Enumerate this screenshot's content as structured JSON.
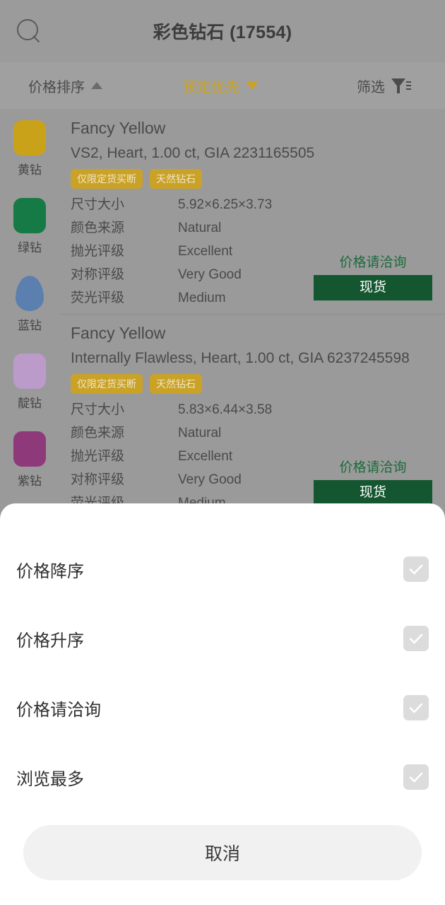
{
  "header": {
    "search_icon": "search-icon",
    "title": "彩色钻石 (17554)"
  },
  "toolbar": {
    "sort_label": "价格排序",
    "sort_caret": "caret-up-icon",
    "booking_label": "预定优先",
    "booking_caret": "caret-down-icon",
    "filter_label": "筛选",
    "filter_icon": "filter-icon",
    "active_color": "#c9a227"
  },
  "rail": {
    "items": [
      {
        "label": "黄钻",
        "color": "#c9a21a",
        "shape": "cushion"
      },
      {
        "label": "绿钻",
        "color": "#157a45",
        "shape": "cushion"
      },
      {
        "label": "蓝钻",
        "color": "#5b7fae",
        "shape": "pear"
      },
      {
        "label": "靛钻",
        "color": "#bb9bc9",
        "shape": "cushion"
      },
      {
        "label": "紫钻",
        "color": "#8e3a7a",
        "shape": "cushion"
      }
    ]
  },
  "listings": [
    {
      "title": "Fancy Yellow",
      "subtitle": "VS2, Heart, 1.00 ct, GIA 2231165505",
      "tags": [
        "仅限定货买断",
        "天然钻石"
      ],
      "specs": [
        {
          "label": "尺寸大小",
          "value": "5.92×6.25×3.73"
        },
        {
          "label": "颜色来源",
          "value": "Natural"
        },
        {
          "label": "抛光评级",
          "value": "Excellent"
        },
        {
          "label": "对称评级",
          "value": "Very Good"
        },
        {
          "label": "荧光评级",
          "value": "Medium"
        }
      ],
      "price_text": "价格请洽询",
      "stock_label": "现货"
    },
    {
      "title": "Fancy Yellow",
      "subtitle": "Internally Flawless, Heart, 1.00 ct, GIA 6237245598",
      "tags": [
        "仅限定货买断",
        "天然钻石"
      ],
      "specs": [
        {
          "label": "尺寸大小",
          "value": "5.83×6.44×3.58"
        },
        {
          "label": "颜色来源",
          "value": "Natural"
        },
        {
          "label": "抛光评级",
          "value": "Excellent"
        },
        {
          "label": "对称评级",
          "value": "Very Good"
        },
        {
          "label": "荧光评级",
          "value": "Medium"
        }
      ],
      "price_text": "价格请洽询",
      "stock_label": "现货"
    }
  ],
  "sheet": {
    "options": [
      {
        "label": "价格降序",
        "checked": false
      },
      {
        "label": "价格升序",
        "checked": false
      },
      {
        "label": "价格请洽询",
        "checked": false
      },
      {
        "label": "浏览最多",
        "checked": false
      }
    ],
    "cancel_label": "取消"
  }
}
